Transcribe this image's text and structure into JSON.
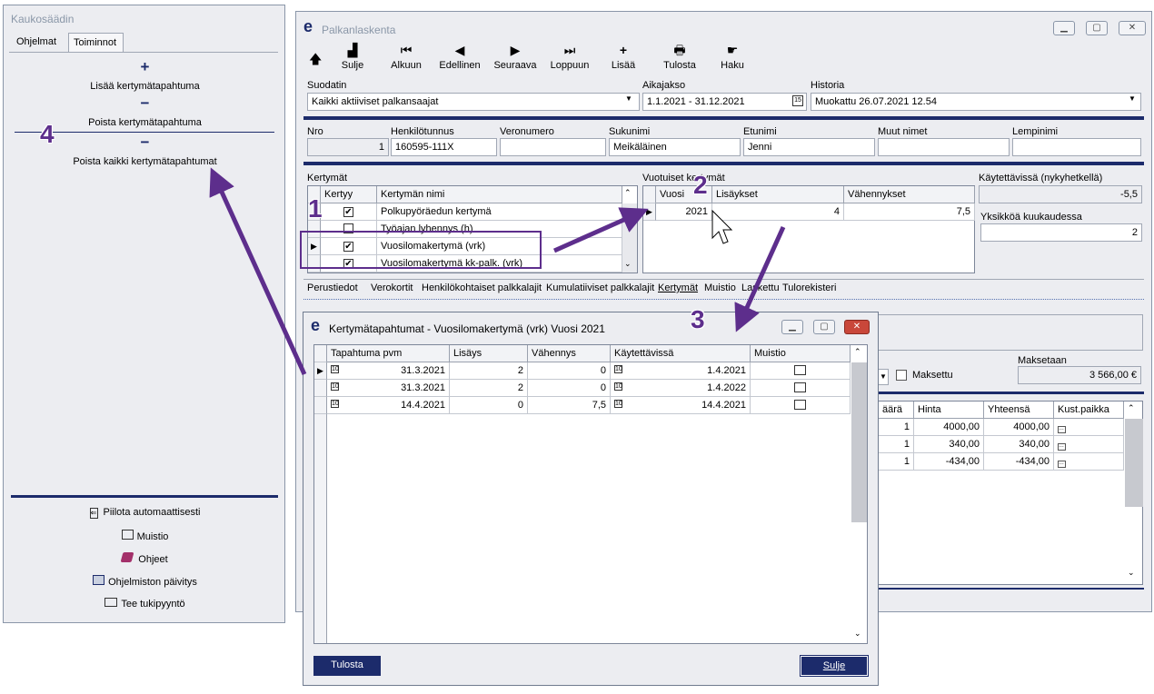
{
  "remote": {
    "title": "Kaukosäädin",
    "tabs": [
      "Ohjelmat",
      "Toiminnot"
    ],
    "actions": [
      {
        "icon": "+",
        "label": "Lisää kertymätapahtuma"
      },
      {
        "icon": "−",
        "label": "Poista kertymätapahtuma"
      },
      {
        "icon": "−",
        "label": "Poista kaikki kertymätapahtumat"
      }
    ],
    "footer": [
      "Piilota automaattisesti",
      "Muistio",
      "Ohjeet",
      "Ohjelmiston päivitys",
      "Tee tukipyyntö"
    ]
  },
  "main": {
    "title": "Palkanlaskenta",
    "toolbar": [
      "Sulje",
      "Alkuun",
      "Edellinen",
      "Seuraava",
      "Loppuun",
      "Lisää",
      "Tulosta",
      "Haku"
    ],
    "filter": {
      "suodatin_label": "Suodatin",
      "suodatin_value": "Kaikki aktiiviset palkansaajat",
      "aikajakso_label": "Aikajakso",
      "aikajakso_value": "1.1.2021 - 31.12.2021",
      "historia_label": "Historia",
      "historia_value": "Muokattu 26.07.2021 12.54"
    },
    "person": {
      "labels": [
        "Nro",
        "Henkilötunnus",
        "Veronumero",
        "Sukunimi",
        "Etunimi",
        "Muut nimet",
        "Lempinimi"
      ],
      "nro": "1",
      "hetu": "160595-111X",
      "veronumero": "",
      "sukunimi": "Meikäläinen",
      "etunimi": "Jenni",
      "muut": "",
      "lempi": ""
    },
    "kertymat": {
      "label": "Kertymät",
      "headers": [
        "Kertyy",
        "Kertymän nimi"
      ],
      "rows": [
        {
          "checked": true,
          "name": "Polkupyöräedun kertymä"
        },
        {
          "checked": false,
          "name": "Työajan lyhennys (h)"
        },
        {
          "checked": true,
          "name": "Vuosilomakertymä (vrk)"
        },
        {
          "checked": true,
          "name": "Vuosilomakertymä kk-palk. (vrk)"
        }
      ]
    },
    "vuotuiset": {
      "label": "Vuotuiset kertymät",
      "headers": [
        "Vuosi",
        "Lisäykset",
        "Vähennykset"
      ],
      "row": {
        "vuosi": "2021",
        "lisaykset": "4",
        "vahennykset": "7,5"
      }
    },
    "kaytettavissa": {
      "label": "Käytettävissä (nykyhetkellä)",
      "value": "-5,5",
      "yks_label": "Yksikköä kuukaudessa",
      "yks_value": "2"
    },
    "tabs": [
      "Perustiedot",
      "Verokortit",
      "Henkilökohtaiset palkkalajit",
      "Kumulatiiviset palkkalajit",
      "Kertymät",
      "Muistio",
      "Laskettu",
      "Tulorekisteri"
    ],
    "maksetaan_label": "Maksetaan",
    "maksetaan_value": "3 566,00 €",
    "maksettu_label": "Maksettu",
    "pay_headers": [
      "äärä",
      "Hinta",
      "Yhteensä",
      "Kust.paikka"
    ],
    "pay_rows": [
      {
        "m": "1",
        "h": "4000,00",
        "y": "4000,00"
      },
      {
        "m": "1",
        "h": "340,00",
        "y": "340,00"
      },
      {
        "m": "1",
        "h": "-434,00",
        "y": "-434,00"
      }
    ]
  },
  "dialog": {
    "title": "Kertymätapahtumat - Vuosilomakertymä (vrk) Vuosi 2021",
    "headers": [
      "Tapahtuma pvm",
      "Lisäys",
      "Vähennys",
      "Käytettävissä",
      "Muistio"
    ],
    "rows": [
      {
        "pvm": "31.3.2021",
        "lisays": "2",
        "vahennys": "0",
        "kaytettavissa": "1.4.2021"
      },
      {
        "pvm": "31.3.2021",
        "lisays": "2",
        "vahennys": "0",
        "kaytettavissa": "1.4.2022"
      },
      {
        "pvm": "14.4.2021",
        "lisays": "0",
        "vahennys": "7,5",
        "kaytettavissa": "14.4.2021"
      }
    ],
    "print": "Tulosta",
    "close": "Sulje"
  },
  "annotations": [
    "1",
    "2",
    "3",
    "4"
  ]
}
